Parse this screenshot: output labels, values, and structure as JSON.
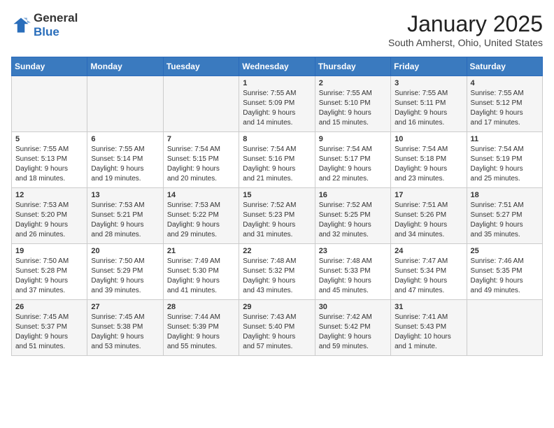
{
  "header": {
    "logo": {
      "general": "General",
      "blue": "Blue"
    },
    "title": "January 2025",
    "location": "South Amherst, Ohio, United States"
  },
  "weekdays": [
    "Sunday",
    "Monday",
    "Tuesday",
    "Wednesday",
    "Thursday",
    "Friday",
    "Saturday"
  ],
  "weeks": [
    [
      {
        "day": "",
        "sunrise": "",
        "sunset": "",
        "daylight": ""
      },
      {
        "day": "",
        "sunrise": "",
        "sunset": "",
        "daylight": ""
      },
      {
        "day": "",
        "sunrise": "",
        "sunset": "",
        "daylight": ""
      },
      {
        "day": "1",
        "sunrise": "7:55 AM",
        "sunset": "5:09 PM",
        "daylight": "9 hours and 14 minutes."
      },
      {
        "day": "2",
        "sunrise": "7:55 AM",
        "sunset": "5:10 PM",
        "daylight": "9 hours and 15 minutes."
      },
      {
        "day": "3",
        "sunrise": "7:55 AM",
        "sunset": "5:11 PM",
        "daylight": "9 hours and 16 minutes."
      },
      {
        "day": "4",
        "sunrise": "7:55 AM",
        "sunset": "5:12 PM",
        "daylight": "9 hours and 17 minutes."
      }
    ],
    [
      {
        "day": "5",
        "sunrise": "7:55 AM",
        "sunset": "5:13 PM",
        "daylight": "9 hours and 18 minutes."
      },
      {
        "day": "6",
        "sunrise": "7:55 AM",
        "sunset": "5:14 PM",
        "daylight": "9 hours and 19 minutes."
      },
      {
        "day": "7",
        "sunrise": "7:54 AM",
        "sunset": "5:15 PM",
        "daylight": "9 hours and 20 minutes."
      },
      {
        "day": "8",
        "sunrise": "7:54 AM",
        "sunset": "5:16 PM",
        "daylight": "9 hours and 21 minutes."
      },
      {
        "day": "9",
        "sunrise": "7:54 AM",
        "sunset": "5:17 PM",
        "daylight": "9 hours and 22 minutes."
      },
      {
        "day": "10",
        "sunrise": "7:54 AM",
        "sunset": "5:18 PM",
        "daylight": "9 hours and 23 minutes."
      },
      {
        "day": "11",
        "sunrise": "7:54 AM",
        "sunset": "5:19 PM",
        "daylight": "9 hours and 25 minutes."
      }
    ],
    [
      {
        "day": "12",
        "sunrise": "7:53 AM",
        "sunset": "5:20 PM",
        "daylight": "9 hours and 26 minutes."
      },
      {
        "day": "13",
        "sunrise": "7:53 AM",
        "sunset": "5:21 PM",
        "daylight": "9 hours and 28 minutes."
      },
      {
        "day": "14",
        "sunrise": "7:53 AM",
        "sunset": "5:22 PM",
        "daylight": "9 hours and 29 minutes."
      },
      {
        "day": "15",
        "sunrise": "7:52 AM",
        "sunset": "5:23 PM",
        "daylight": "9 hours and 31 minutes."
      },
      {
        "day": "16",
        "sunrise": "7:52 AM",
        "sunset": "5:25 PM",
        "daylight": "9 hours and 32 minutes."
      },
      {
        "day": "17",
        "sunrise": "7:51 AM",
        "sunset": "5:26 PM",
        "daylight": "9 hours and 34 minutes."
      },
      {
        "day": "18",
        "sunrise": "7:51 AM",
        "sunset": "5:27 PM",
        "daylight": "9 hours and 35 minutes."
      }
    ],
    [
      {
        "day": "19",
        "sunrise": "7:50 AM",
        "sunset": "5:28 PM",
        "daylight": "9 hours and 37 minutes."
      },
      {
        "day": "20",
        "sunrise": "7:50 AM",
        "sunset": "5:29 PM",
        "daylight": "9 hours and 39 minutes."
      },
      {
        "day": "21",
        "sunrise": "7:49 AM",
        "sunset": "5:30 PM",
        "daylight": "9 hours and 41 minutes."
      },
      {
        "day": "22",
        "sunrise": "7:48 AM",
        "sunset": "5:32 PM",
        "daylight": "9 hours and 43 minutes."
      },
      {
        "day": "23",
        "sunrise": "7:48 AM",
        "sunset": "5:33 PM",
        "daylight": "9 hours and 45 minutes."
      },
      {
        "day": "24",
        "sunrise": "7:47 AM",
        "sunset": "5:34 PM",
        "daylight": "9 hours and 47 minutes."
      },
      {
        "day": "25",
        "sunrise": "7:46 AM",
        "sunset": "5:35 PM",
        "daylight": "9 hours and 49 minutes."
      }
    ],
    [
      {
        "day": "26",
        "sunrise": "7:45 AM",
        "sunset": "5:37 PM",
        "daylight": "9 hours and 51 minutes."
      },
      {
        "day": "27",
        "sunrise": "7:45 AM",
        "sunset": "5:38 PM",
        "daylight": "9 hours and 53 minutes."
      },
      {
        "day": "28",
        "sunrise": "7:44 AM",
        "sunset": "5:39 PM",
        "daylight": "9 hours and 55 minutes."
      },
      {
        "day": "29",
        "sunrise": "7:43 AM",
        "sunset": "5:40 PM",
        "daylight": "9 hours and 57 minutes."
      },
      {
        "day": "30",
        "sunrise": "7:42 AM",
        "sunset": "5:42 PM",
        "daylight": "9 hours and 59 minutes."
      },
      {
        "day": "31",
        "sunrise": "7:41 AM",
        "sunset": "5:43 PM",
        "daylight": "10 hours and 1 minute."
      },
      {
        "day": "",
        "sunrise": "",
        "sunset": "",
        "daylight": ""
      }
    ]
  ]
}
